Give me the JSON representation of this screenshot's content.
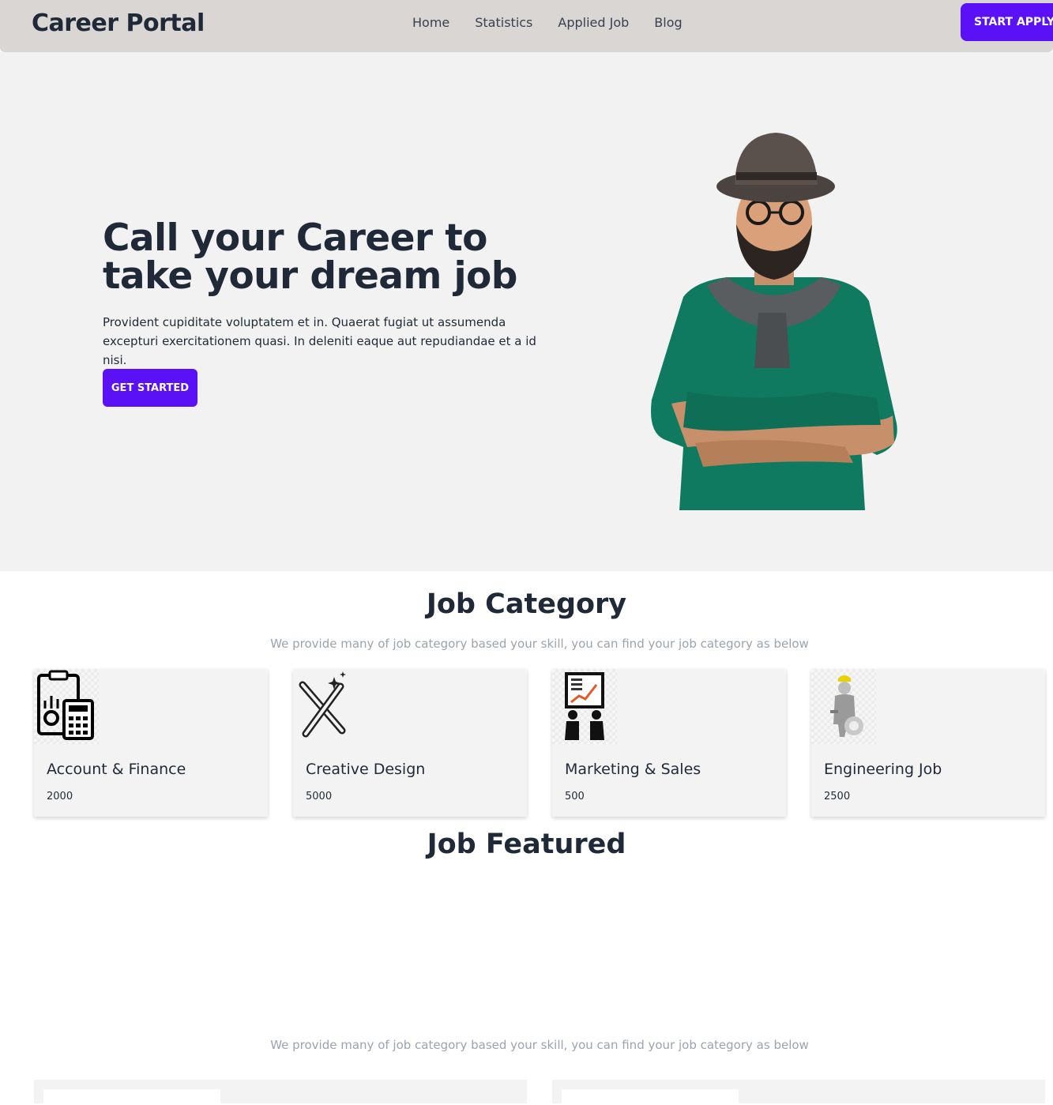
{
  "navbar": {
    "brand": "Career Portal",
    "links": [
      "Home",
      "Statistics",
      "Applied Job",
      "Blog"
    ],
    "cta": "START APPLYING"
  },
  "hero": {
    "title": "Call your Career to take your dream job",
    "description": "Provident cupiditate voluptatem et in. Quaerat fugiat ut assumenda excepturi exercitationem quasi. In deleniti eaque aut repudiandae et a id nisi.",
    "button": "GET STARTED"
  },
  "job_category": {
    "title": "Job Category",
    "subtitle": "We provide many of job category based your skill, you can find your job category as below",
    "cards": [
      {
        "title": "Account & Finance",
        "count": "2000",
        "icon": "accounting-icon"
      },
      {
        "title": "Creative Design",
        "count": "5000",
        "icon": "design-tools-icon"
      },
      {
        "title": "Marketing & Sales",
        "count": "500",
        "icon": "presentation-icon"
      },
      {
        "title": "Engineering Job",
        "count": "2500",
        "icon": "engineer-icon"
      }
    ]
  },
  "job_featured": {
    "title": "Job Featured",
    "subtitle": "We provide many of job category based your skill, you can find your job category as below"
  },
  "colors": {
    "accent": "#5b11f5",
    "navbar_bg": "#d9d6d4",
    "hero_bg": "#f2f2f2"
  }
}
